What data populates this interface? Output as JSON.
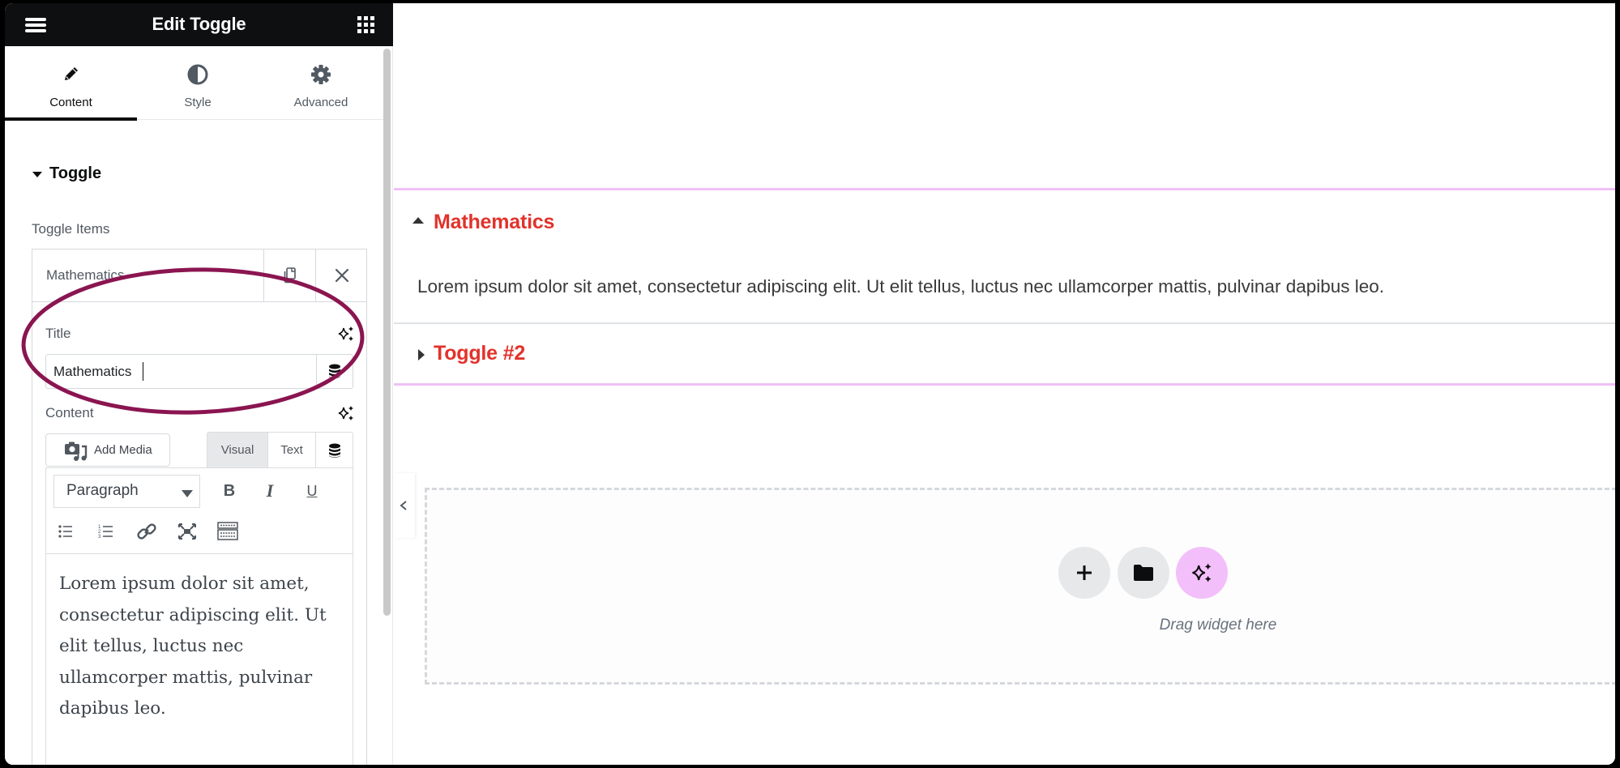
{
  "panel": {
    "header_title": "Edit Toggle",
    "menu_icon": "hamburger-icon",
    "widgets_icon": "grid-icon",
    "tabs": [
      {
        "label": "Content",
        "icon": "pencil-icon",
        "active": true
      },
      {
        "label": "Style",
        "icon": "half-circle-icon",
        "active": false
      },
      {
        "label": "Advanced",
        "icon": "gear-icon",
        "active": false
      }
    ],
    "section_title": "Toggle",
    "toggle_items_label": "Toggle Items",
    "repeater_item": {
      "title": "Mathematics",
      "copy_icon": "duplicate-icon",
      "remove_icon": "close-icon"
    },
    "title_field": {
      "label": "Title",
      "value": "Mathematics",
      "ai_icon": "sparkle-icon",
      "dynamic_icon": "database-icon"
    },
    "content_field": {
      "label": "Content",
      "ai_icon": "sparkle-icon",
      "add_media_label": "Add Media",
      "editor_tabs": [
        "Visual",
        "Text"
      ],
      "active_editor_tab": "Visual",
      "format_select": "Paragraph",
      "toolbar_row1": [
        "bold",
        "italic",
        "underline"
      ],
      "toolbar_row2": [
        "bulleted-list",
        "numbered-list",
        "link",
        "fullscreen",
        "toolbar-toggle"
      ],
      "body": "Lorem ipsum dolor sit amet, consectetur adipiscing elit. Ut elit tellus, luctus nec ullamcorper mattis, pulvinar dapibus leo."
    }
  },
  "canvas": {
    "toggles": [
      {
        "title": "Mathematics",
        "expanded": true,
        "content": "Lorem ipsum dolor sit amet, consectetur adipiscing elit. Ut elit tellus, luctus nec ullamcorper mattis, pulvinar dapibus leo."
      },
      {
        "title": "Toggle #2",
        "expanded": false
      }
    ],
    "dropzone": {
      "text": "Drag widget here",
      "buttons": [
        "add-section",
        "template-library",
        "ai-assistant"
      ]
    }
  },
  "colors": {
    "header_bg": "#0e0f11",
    "toggle_title": "#e2322b",
    "selection_outline": "#f0c0f7",
    "ai_button": "#f3bffa",
    "annotation": "#8a1550"
  },
  "annotation": {
    "shape": "ellipse",
    "highlights": "title-field"
  }
}
